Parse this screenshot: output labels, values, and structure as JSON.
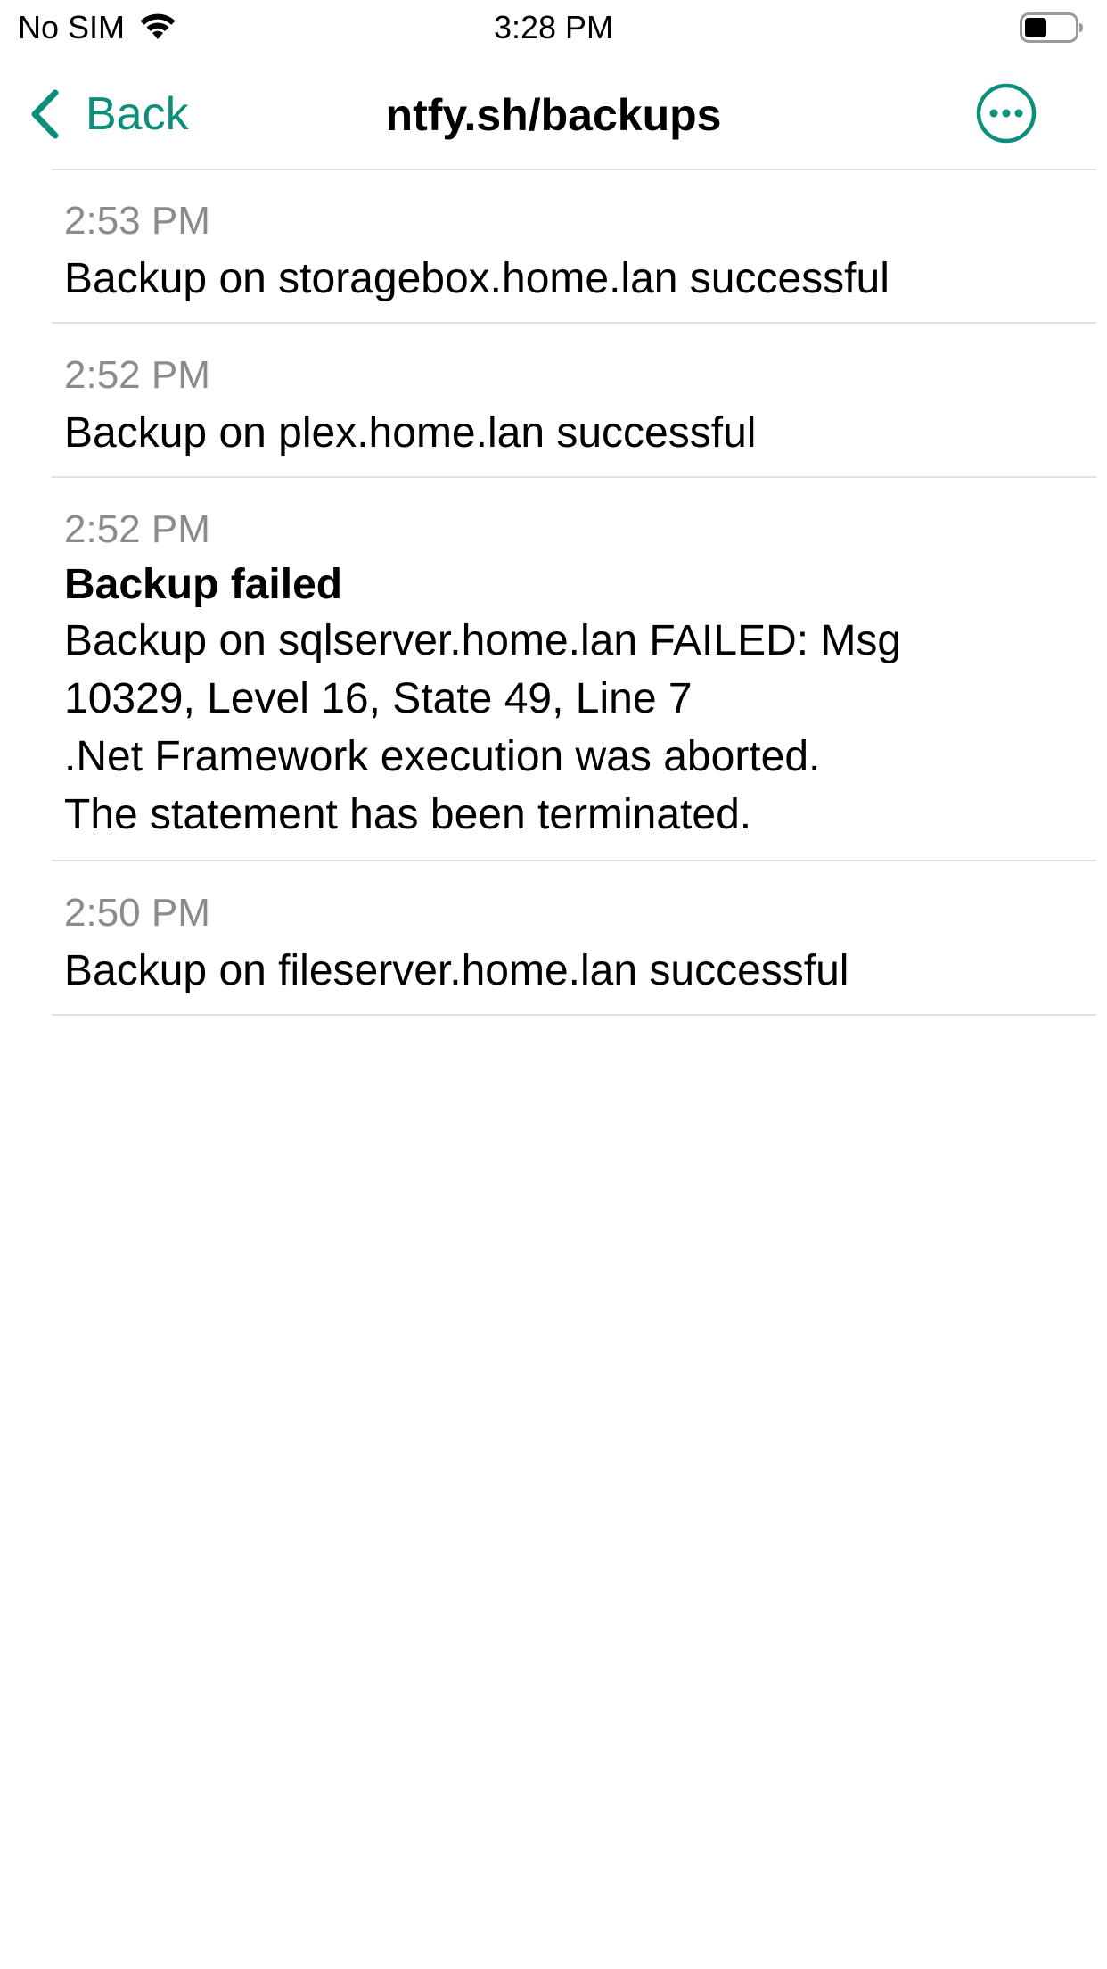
{
  "status_bar": {
    "carrier": "No SIM",
    "time": "3:28 PM"
  },
  "nav": {
    "back_label": "Back",
    "title": "ntfy.sh/backups"
  },
  "notifications": [
    {
      "time": "2:53 PM",
      "title": "",
      "message": "Backup on storagebox.home.lan successful"
    },
    {
      "time": "2:52 PM",
      "title": "",
      "message": "Backup on plex.home.lan successful"
    },
    {
      "time": "2:52 PM",
      "title": "Backup failed",
      "message": "Backup on sqlserver.home.lan FAILED: Msg\n10329, Level 16, State 49, Line 7\n.Net Framework execution was aborted.\nThe statement has been terminated."
    },
    {
      "time": "2:50 PM",
      "title": "",
      "message": "Backup on fileserver.home.lan successful"
    }
  ],
  "colors": {
    "accent": "#0c8f7a",
    "secondary_text": "#8a8a8f",
    "divider": "#e2e2e2"
  },
  "icons": {
    "wifi": "wifi-icon",
    "battery": "battery-icon",
    "back": "chevron-left-icon",
    "more": "more-horizontal-circle-icon"
  }
}
